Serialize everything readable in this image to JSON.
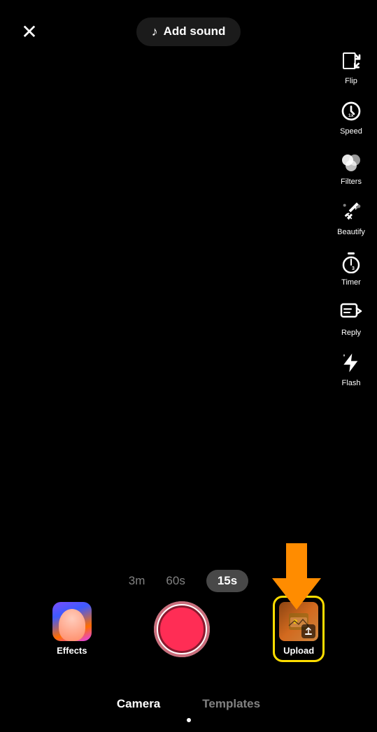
{
  "header": {
    "close_label": "×",
    "add_sound_label": "Add sound",
    "music_icon": "♪"
  },
  "sidebar": {
    "items": [
      {
        "id": "flip",
        "label": "Flip"
      },
      {
        "id": "speed",
        "label": "Speed"
      },
      {
        "id": "filters",
        "label": "Filters"
      },
      {
        "id": "beautify",
        "label": "Beautify"
      },
      {
        "id": "timer",
        "label": "Timer"
      },
      {
        "id": "reply",
        "label": "Reply"
      },
      {
        "id": "flash",
        "label": "Flash"
      }
    ]
  },
  "duration": {
    "options": [
      {
        "id": "3m",
        "label": "3m",
        "active": false
      },
      {
        "id": "60s",
        "label": "60s",
        "active": false
      },
      {
        "id": "15s",
        "label": "15s",
        "active": true
      }
    ]
  },
  "bottom_controls": {
    "effects_label": "Effects",
    "upload_label": "Upload"
  },
  "bottom_nav": {
    "camera_label": "Camera",
    "templates_label": "Templates"
  }
}
